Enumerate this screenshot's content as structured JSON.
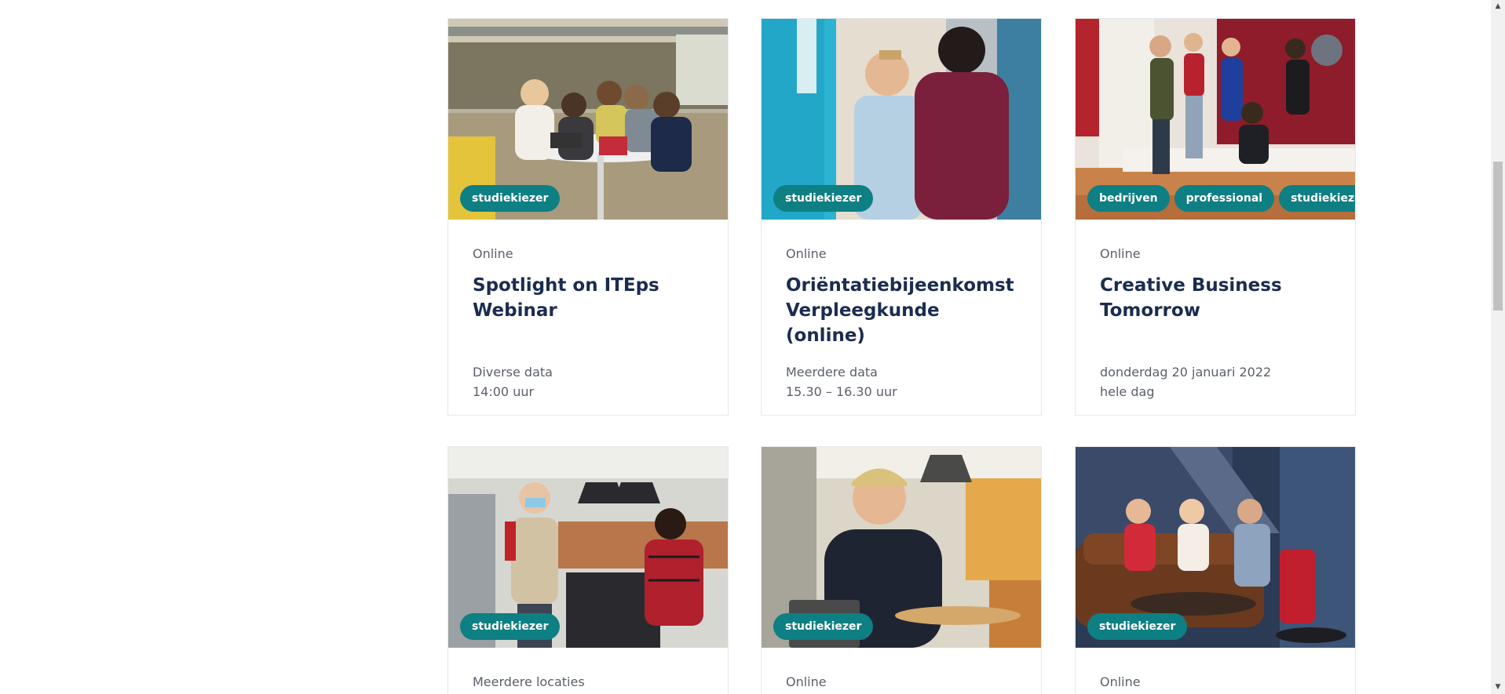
{
  "events": [
    {
      "tags": [
        "studiekiezer"
      ],
      "location": "Online",
      "title": "Spotlight on ITEps Webinar",
      "date": "Diverse data",
      "time": "14:00 uur"
    },
    {
      "tags": [
        "studiekiezer"
      ],
      "location": "Online",
      "title": "Oriëntatiebijeenkomst Verpleegkunde (online)",
      "date": "Meerdere data",
      "time": "15.30 – 16.30 uur"
    },
    {
      "tags": [
        "bedrijven",
        "professional",
        "studiekiezer"
      ],
      "location": "Online",
      "title": "Creative Business Tomorrow",
      "date": "donderdag 20 januari 2022",
      "time": "hele dag"
    },
    {
      "tags": [
        "studiekiezer"
      ],
      "location": "Meerdere locaties"
    },
    {
      "tags": [
        "studiekiezer"
      ],
      "location": "Online"
    },
    {
      "tags": [
        "studiekiezer"
      ],
      "location": "Online"
    }
  ],
  "colors": {
    "tag_bg": "#0e7f82",
    "title": "#1b2c4f",
    "meta_text": "#5a5f6a"
  },
  "icons": {
    "scroll_up": "triangle-up-icon",
    "scroll_down": "triangle-down-icon"
  }
}
